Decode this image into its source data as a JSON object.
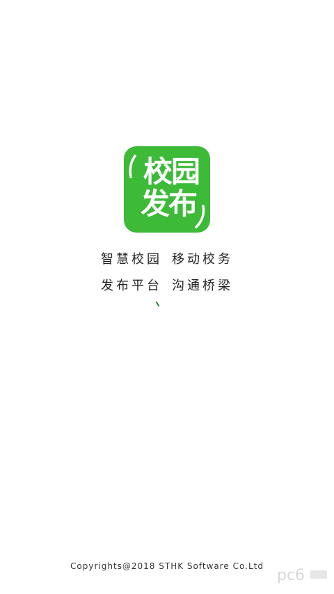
{
  "logo": {
    "line1": "校园",
    "line2": "发布",
    "color": "#3cba38"
  },
  "slogan": {
    "line1_left": "智慧校园",
    "line1_right": "移动校务",
    "line2_left": "发布平台",
    "line2_right": "沟通桥梁"
  },
  "loading": {
    "icon": "loading-spinner-icon",
    "color": "#2a7a3a"
  },
  "footer": {
    "copyright": "Copyrights@2018 STHK Software Co.Ltd"
  },
  "watermark": {
    "text": "pc6"
  }
}
